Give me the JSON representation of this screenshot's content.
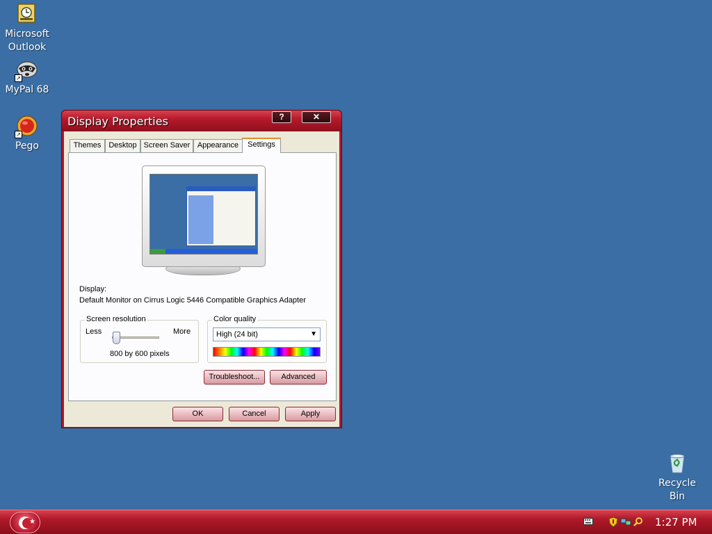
{
  "desktop": {
    "icons": [
      {
        "label_line1": "Microsoft",
        "label_line2": "Outlook",
        "icon": "outlook-icon"
      },
      {
        "label_line1": "MyPal 68",
        "label_line2": "",
        "icon": "mypal-icon"
      },
      {
        "label_line1": "Pego",
        "label_line2": "",
        "icon": "pego-icon"
      },
      {
        "label_line1": "Recycle",
        "label_line2": "Bin",
        "icon": "recycle-bin-icon"
      }
    ]
  },
  "window": {
    "title": "Display Properties",
    "help_btn": "?",
    "close_btn": "✕",
    "tabs": [
      {
        "label": "Themes",
        "active": false
      },
      {
        "label": "Desktop",
        "active": false
      },
      {
        "label": "Screen Saver",
        "active": false
      },
      {
        "label": "Appearance",
        "active": false
      },
      {
        "label": "Settings",
        "active": true
      }
    ],
    "display_label": "Display:",
    "display_value": "Default Monitor on Cirrus Logic 5446 Compatible Graphics Adapter",
    "resolution": {
      "legend": "Screen resolution",
      "less": "Less",
      "more": "More",
      "value": "800 by 600 pixels",
      "slider_position": 0.1
    },
    "color_quality": {
      "legend": "Color quality",
      "selected": "High (24 bit)"
    },
    "troubleshoot_btn": "Troubleshoot...",
    "advanced_btn": "Advanced",
    "ok_btn": "OK",
    "cancel_btn": "Cancel",
    "apply_btn": "Apply"
  },
  "taskbar": {
    "clock": "1:27 PM",
    "tray_icons": [
      "keyboard-icon",
      "security-shield-icon",
      "network-icon",
      "search-icon"
    ]
  },
  "colors": {
    "desktop_bg": "#3a6ea5",
    "window_frame": "#b0182a",
    "taskbar": "#b01a2a"
  }
}
